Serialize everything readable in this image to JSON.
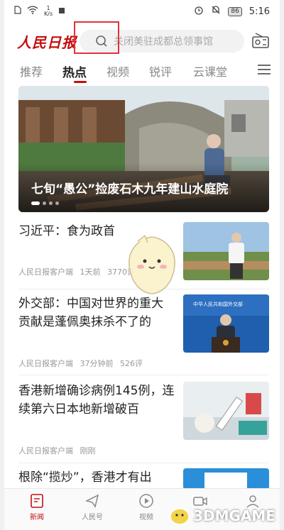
{
  "statusbar": {
    "speed_value": "1",
    "speed_unit": "K/s",
    "battery": "86",
    "time": "5:16"
  },
  "header": {
    "logo_text": "人民日报",
    "search_placeholder": "关闭美驻成都总领事馆"
  },
  "tabs": [
    {
      "label": "推荐"
    },
    {
      "label": "热点"
    },
    {
      "label": "视频"
    },
    {
      "label": "锐评"
    },
    {
      "label": "云课堂"
    }
  ],
  "hero": {
    "title": "七旬“愚公”捡废石木九年建山水庭院"
  },
  "news": [
    {
      "title": "习近平：食为政首",
      "source": "人民日报客户端",
      "time": "1天前",
      "comments": "3770评"
    },
    {
      "title": "外交部：中国对世界的重大贡献是蓬佩奥抹杀不了的",
      "source": "人民日报客户端",
      "time": "37分钟前",
      "comments": "526评"
    },
    {
      "title": "香港新增确诊病例145例，连续第六日本地新增破百",
      "source": "人民日报客户端",
      "time": "刚刚",
      "comments": ""
    },
    {
      "title": "根除“揽炒”，香港才有出",
      "source": "",
      "time": "",
      "comments": ""
    }
  ],
  "thumb2_text": "中华人民共和国外交部",
  "bottom_nav": [
    {
      "label": "新闻"
    },
    {
      "label": "人民号"
    },
    {
      "label": "视频"
    },
    {
      "label": ""
    },
    {
      "label": ""
    }
  ],
  "watermark": "3DMGAME",
  "colors": {
    "accent": "#c40f0f",
    "highlight": "#e0323e"
  }
}
